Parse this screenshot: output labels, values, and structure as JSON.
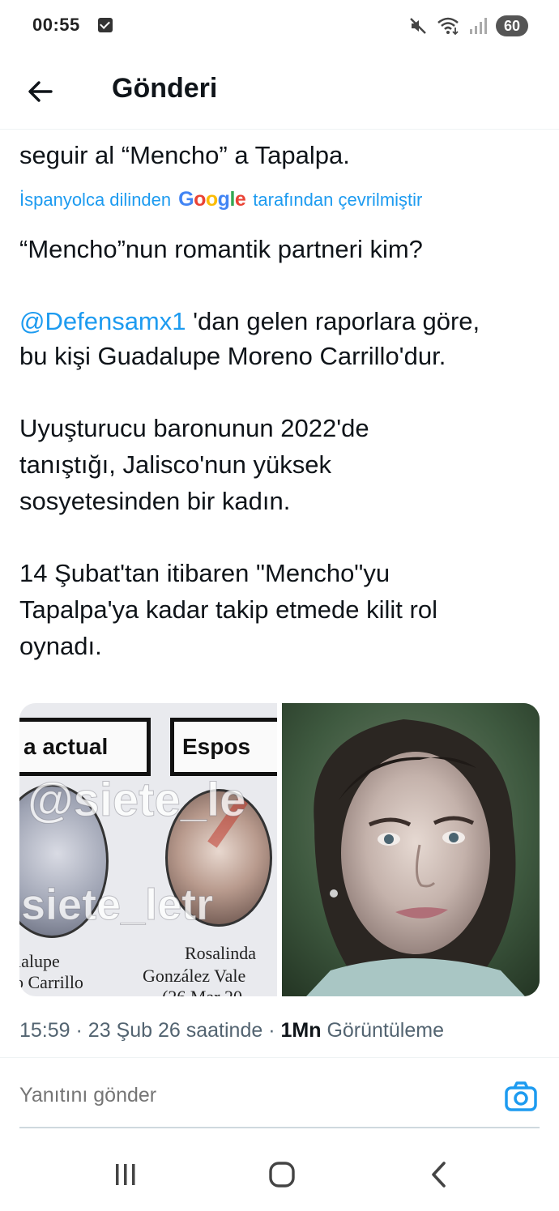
{
  "status_bar": {
    "time": "00:55",
    "battery": "60",
    "icons": [
      "checkbox-notification-icon",
      "mute-icon",
      "wifi-icon",
      "signal-icon"
    ]
  },
  "header": {
    "title": "Gönderi",
    "back_icon": "arrow-left-icon"
  },
  "tweet": {
    "previous_line": "seguir al “Mencho” a Tapalpa.",
    "translation_note": {
      "prefix": "İspanyolca dilinden",
      "brand_letters": [
        "G",
        "o",
        "o",
        "g",
        "l",
        "e"
      ],
      "suffix": "tarafından çevrilmiştir"
    },
    "line_question": "“Mencho”nun romantik partneri kim?",
    "mention": "@Defensamx1",
    "line_mention_rest": " 'dan gelen raporlara göre,",
    "line_identity": "bu kişi Guadalupe Moreno Carrillo'dur.",
    "paragraph_3": [
      "Uyuşturucu baronunun 2022'de",
      "tanıştığı, Jalisco'nun yüksek",
      "sosyetesinden bir kadın."
    ],
    "paragraph_4": [
      "14 Şubat'tan itibaren \"Mencho\"yu",
      "Tapalpa'ya kadar takip etmede kilit rol",
      "oynadı."
    ]
  },
  "media": {
    "left_image": {
      "labels": [
        "a actual",
        "Espos"
      ],
      "watermark_top": "@siete_le",
      "watermark_bottom": "siete_letr",
      "caption_left": [
        "lalupe",
        "o Carrillo"
      ],
      "caption_right": [
        "Rosalinda",
        "González Vale",
        "(26 Mar 20"
      ]
    },
    "right_image": {
      "description_icon": "portrait-photo"
    }
  },
  "meta": {
    "time": "15:59",
    "date": "23 Şub 26 saatinde",
    "views_count": "1Mn",
    "views_label": "Görüntüleme",
    "separator": "·"
  },
  "reply": {
    "placeholder": "Yanıtını gönder",
    "camera_icon": "camera-icon",
    "accent": "#1d9bf0"
  },
  "nav_bar": {
    "icons": [
      "recents-icon",
      "home-icon",
      "back-icon"
    ]
  }
}
